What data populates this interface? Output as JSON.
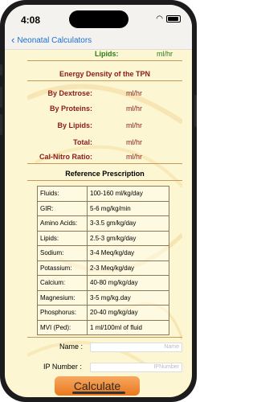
{
  "status": {
    "time": "4:08"
  },
  "nav": {
    "back_label": "Neonatal Calculators"
  },
  "lipids": {
    "label": "Lipids:",
    "unit": "ml/hr"
  },
  "energy": {
    "title": "Energy Density of the TPN",
    "rows": [
      {
        "label": "By Dextrose:",
        "unit": "ml/hr"
      },
      {
        "label": "By Proteins:",
        "unit": "ml/hr"
      },
      {
        "label": "By Lipids:",
        "unit": "ml/hr"
      },
      {
        "label": "Total:",
        "unit": "ml/hr"
      },
      {
        "label": "Cal-Nitro Ratio:",
        "unit": "ml/hr"
      }
    ]
  },
  "reference": {
    "title": "Reference Prescription",
    "rows": [
      {
        "key": "Fluids:",
        "value": "100-160 ml/kg/day"
      },
      {
        "key": "GIR:",
        "value": "5-6 mg/kg/min"
      },
      {
        "key": "Amino Acids:",
        "value": "3-3.5 gm/kg/day"
      },
      {
        "key": "Lipids:",
        "value": "2.5-3 gm/kg/day"
      },
      {
        "key": "Sodium:",
        "value": "3-4 Meq/kg/day"
      },
      {
        "key": "Potassium:",
        "value": "2-3 Meq/kg/day"
      },
      {
        "key": "Calcium:",
        "value": "40-80 mg/kg/day"
      },
      {
        "key": "Magnesium:",
        "value": "3-5 mg/kg.day"
      },
      {
        "key": "Phosphorus:",
        "value": "20-40 mg/kg/day"
      },
      {
        "key": "MVI (Ped):",
        "value": "1 ml/100ml of fluid"
      }
    ]
  },
  "form": {
    "name_label": "Name :",
    "name_placeholder": "Name",
    "ip_label": "IP Number :",
    "ip_placeholder": "IPNumber"
  },
  "calculate_label": "Calculate"
}
